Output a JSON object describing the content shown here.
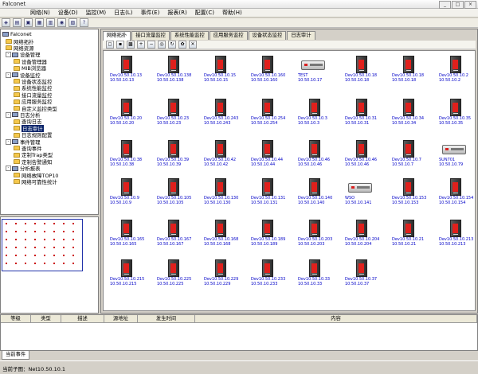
{
  "window": {
    "title": "Falconet"
  },
  "menu": [
    "网络(N)",
    "设备(D)",
    "监控(M)",
    "日志(L)",
    "事件(E)",
    "报表(R)",
    "配置(C)",
    "帮助(H)"
  ],
  "tree": {
    "root": "Falconet",
    "items": [
      {
        "label": "网络拓扑",
        "level": 1,
        "kind": "folder"
      },
      {
        "label": "网络资源",
        "level": 1,
        "kind": "folder"
      },
      {
        "label": "设备管理",
        "level": 1,
        "kind": "pc",
        "expander": "-"
      },
      {
        "label": "设备管理器",
        "level": 2,
        "kind": "folder"
      },
      {
        "label": "MIB浏览器",
        "level": 2,
        "kind": "folder"
      },
      {
        "label": "设备监控",
        "level": 1,
        "kind": "pc",
        "expander": "-"
      },
      {
        "label": "设备状态监控",
        "level": 2,
        "kind": "folder"
      },
      {
        "label": "系统性能监控",
        "level": 2,
        "kind": "folder"
      },
      {
        "label": "接口流量监控",
        "level": 2,
        "kind": "folder"
      },
      {
        "label": "应用服务监控",
        "level": 2,
        "kind": "folder"
      },
      {
        "label": "自定义监控类型",
        "level": 2,
        "kind": "folder"
      },
      {
        "label": "日志分析",
        "level": 1,
        "kind": "pc",
        "expander": "-"
      },
      {
        "label": "查询日志",
        "level": 2,
        "kind": "folder"
      },
      {
        "label": "日志审计",
        "level": 2,
        "kind": "folder",
        "selected": true
      },
      {
        "label": "日志规则配置",
        "level": 2,
        "kind": "folder"
      },
      {
        "label": "事件管理",
        "level": 1,
        "kind": "pc",
        "expander": "-"
      },
      {
        "label": "查询事件",
        "level": 2,
        "kind": "folder"
      },
      {
        "label": "定制Trap类型",
        "level": 2,
        "kind": "folder"
      },
      {
        "label": "定制告警通知",
        "level": 2,
        "kind": "folder"
      },
      {
        "label": "分析报表",
        "level": 1,
        "kind": "pc",
        "expander": "-"
      },
      {
        "label": "网络故障TOP10",
        "level": 2,
        "kind": "folder"
      },
      {
        "label": "网络可靠性统计",
        "level": 2,
        "kind": "folder"
      }
    ]
  },
  "tabs": [
    "网络拓扑",
    "接口流量监控",
    "系统性能监控",
    "应用服务监控",
    "设备状态监控",
    "日志审计"
  ],
  "devices": [
    {
      "l1": "Dev10.50.10.13",
      "l2": "10.50.10.13",
      "type": "server"
    },
    {
      "l1": "Dev10.50.10.138",
      "l2": "10.50.10.138",
      "type": "server"
    },
    {
      "l1": "Dev10.50.10.15",
      "l2": "10.50.10.15",
      "type": "server"
    },
    {
      "l1": "Dev10.50.10.160",
      "l2": "10.50.10.160",
      "type": "server"
    },
    {
      "l1": "TEST",
      "l2": "10.50.10.17",
      "type": "router"
    },
    {
      "l1": "Dev10.50.10.18",
      "l2": "10.50.10.18",
      "type": "server"
    },
    {
      "l1": "Dev10.50.10.18",
      "l2": "10.50.10.18",
      "type": "server"
    },
    {
      "l1": "Dev10.50.10.2",
      "l2": "10.50.10.2",
      "type": "server"
    },
    {
      "l1": "Dev10.50.10.20",
      "l2": "10.50.10.20",
      "type": "server"
    },
    {
      "l1": "Dev10.50.10.23",
      "l2": "10.50.10.23",
      "type": "server"
    },
    {
      "l1": "Dev10.50.10.243",
      "l2": "10.50.10.243",
      "type": "server"
    },
    {
      "l1": "Dev10.50.10.254",
      "l2": "10.50.10.254",
      "type": "server"
    },
    {
      "l1": "Dev10.50.10.3",
      "l2": "10.50.10.3",
      "type": "server"
    },
    {
      "l1": "Dev10.50.10.31",
      "l2": "10.50.10.31",
      "type": "server"
    },
    {
      "l1": "Dev10.50.10.34",
      "l2": "10.50.10.34",
      "type": "server"
    },
    {
      "l1": "Dev10.50.10.35",
      "l2": "10.50.10.35",
      "type": "server"
    },
    {
      "l1": "Dev10.50.10.38",
      "l2": "10.50.10.38",
      "type": "server"
    },
    {
      "l1": "Dev10.50.10.39",
      "l2": "10.50.10.39",
      "type": "server"
    },
    {
      "l1": "Dev10.50.10.42",
      "l2": "10.50.10.42",
      "type": "server"
    },
    {
      "l1": "Dev10.50.10.44",
      "l2": "10.50.10.44",
      "type": "server"
    },
    {
      "l1": "Dev10.50.10.46",
      "l2": "10.50.10.46",
      "type": "server"
    },
    {
      "l1": "Dev10.50.10.46",
      "l2": "10.50.10.46",
      "type": "server"
    },
    {
      "l1": "Dev10.50.10.7",
      "l2": "10.50.10.7",
      "type": "server"
    },
    {
      "l1": "SUN701",
      "l2": "10.50.10.79",
      "type": "router"
    },
    {
      "l1": "Dev10.50.10.9",
      "l2": "10.50.10.9",
      "type": "server"
    },
    {
      "l1": "Dev10.50.10.105",
      "l2": "10.50.10.105",
      "type": "server"
    },
    {
      "l1": "Dev10.50.10.130",
      "l2": "10.50.10.130",
      "type": "server"
    },
    {
      "l1": "Dev10.50.10.131",
      "l2": "10.50.10.131",
      "type": "server"
    },
    {
      "l1": "Dev10.50.10.140",
      "l2": "10.50.10.140",
      "type": "server"
    },
    {
      "l1": "WSO",
      "l2": "10.50.10.141",
      "type": "router"
    },
    {
      "l1": "Dev10.50.10.153",
      "l2": "10.50.10.153",
      "type": "server"
    },
    {
      "l1": "Dev10.50.10.154",
      "l2": "10.50.10.154",
      "type": "server"
    },
    {
      "l1": "Dev10.50.10.165",
      "l2": "10.50.10.165",
      "type": "server"
    },
    {
      "l1": "Dev10.50.10.167",
      "l2": "10.50.10.167",
      "type": "server"
    },
    {
      "l1": "Dev10.50.10.168",
      "l2": "10.50.10.168",
      "type": "server"
    },
    {
      "l1": "Dev10.50.10.189",
      "l2": "10.50.10.189",
      "type": "server"
    },
    {
      "l1": "Dev10.50.10.203",
      "l2": "10.50.10.203",
      "type": "server"
    },
    {
      "l1": "Dev10.50.10.204",
      "l2": "10.50.10.204",
      "type": "server"
    },
    {
      "l1": "Dev10.50.10.21",
      "l2": "10.50.10.21",
      "type": "server"
    },
    {
      "l1": "Dev10.50.10.213",
      "l2": "10.50.10.213",
      "type": "server"
    },
    {
      "l1": "Dev10.50.10.215",
      "l2": "10.50.10.215",
      "type": "server"
    },
    {
      "l1": "Dev10.50.10.225",
      "l2": "10.50.10.225",
      "type": "server"
    },
    {
      "l1": "Dev10.50.10.229",
      "l2": "10.50.10.229",
      "type": "server"
    },
    {
      "l1": "Dev10.50.10.233",
      "l2": "10.50.10.233",
      "type": "server"
    },
    {
      "l1": "Dev10.50.10.33",
      "l2": "10.50.10.33",
      "type": "server"
    },
    {
      "l1": "Dev10.50.10.37",
      "l2": "10.50.10.37",
      "type": "server"
    }
  ],
  "event_columns": [
    "等级",
    "类型",
    "描述",
    "源地址",
    "发生时间",
    "内容"
  ],
  "event_tab": "当前事件",
  "status": {
    "text": "当前子图：Net10.50.10.1"
  }
}
